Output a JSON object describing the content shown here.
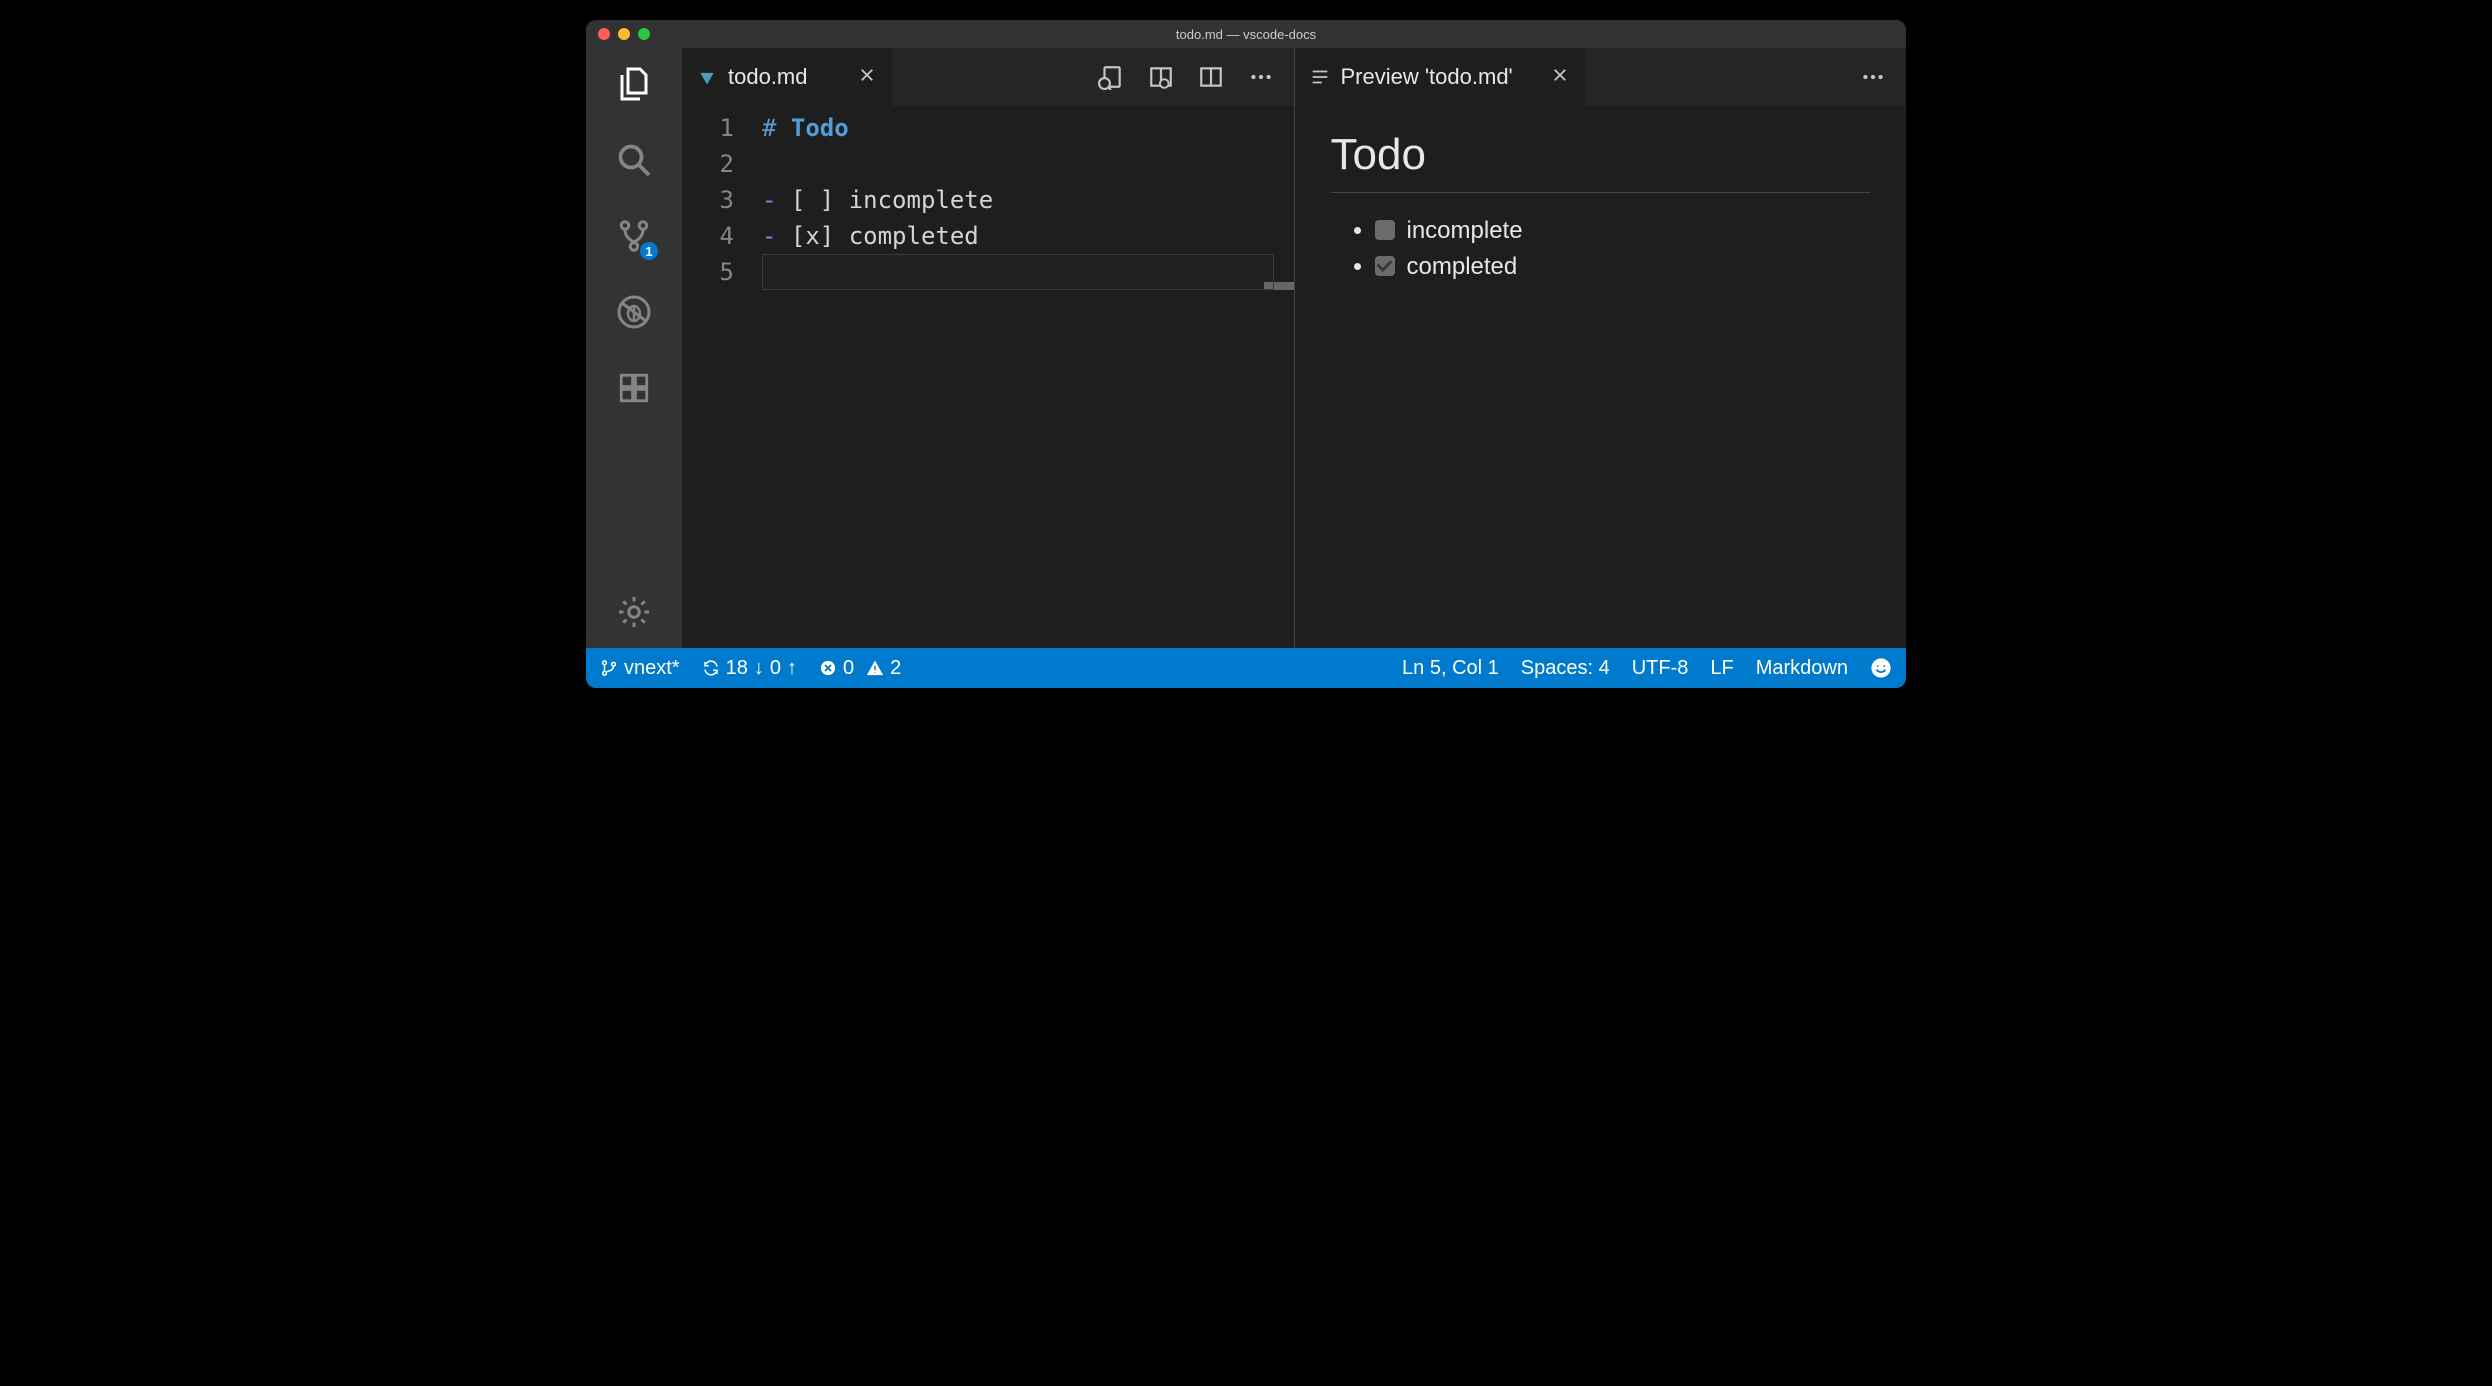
{
  "title": "todo.md — vscode-docs",
  "activity": {
    "scm_badge": "1"
  },
  "left": {
    "tab": {
      "label": "todo.md"
    },
    "lines": [
      {
        "n": "1",
        "tokens": [
          {
            "t": "# ",
            "c": "tok-punct"
          },
          {
            "t": "Todo",
            "c": "tok-head"
          }
        ]
      },
      {
        "n": "2",
        "tokens": []
      },
      {
        "n": "3",
        "tokens": [
          {
            "t": "- ",
            "c": "tok-list"
          },
          {
            "t": "[ ] incomplete",
            "c": ""
          }
        ]
      },
      {
        "n": "4",
        "tokens": [
          {
            "t": "- ",
            "c": "tok-list"
          },
          {
            "t": "[x] completed",
            "c": ""
          }
        ]
      },
      {
        "n": "5",
        "tokens": []
      }
    ],
    "highlight_index": 4
  },
  "right": {
    "tab": {
      "label": "Preview 'todo.md'"
    },
    "heading": "Todo",
    "items": [
      {
        "checked": false,
        "text": "incomplete"
      },
      {
        "checked": true,
        "text": "completed"
      }
    ]
  },
  "status": {
    "branch": "vnext*",
    "sync_down": "18",
    "sync_up": "0",
    "errors": "0",
    "warnings": "2",
    "cursor": "Ln 5, Col 1",
    "indent": "Spaces: 4",
    "encoding": "UTF-8",
    "eol": "LF",
    "lang": "Markdown"
  }
}
